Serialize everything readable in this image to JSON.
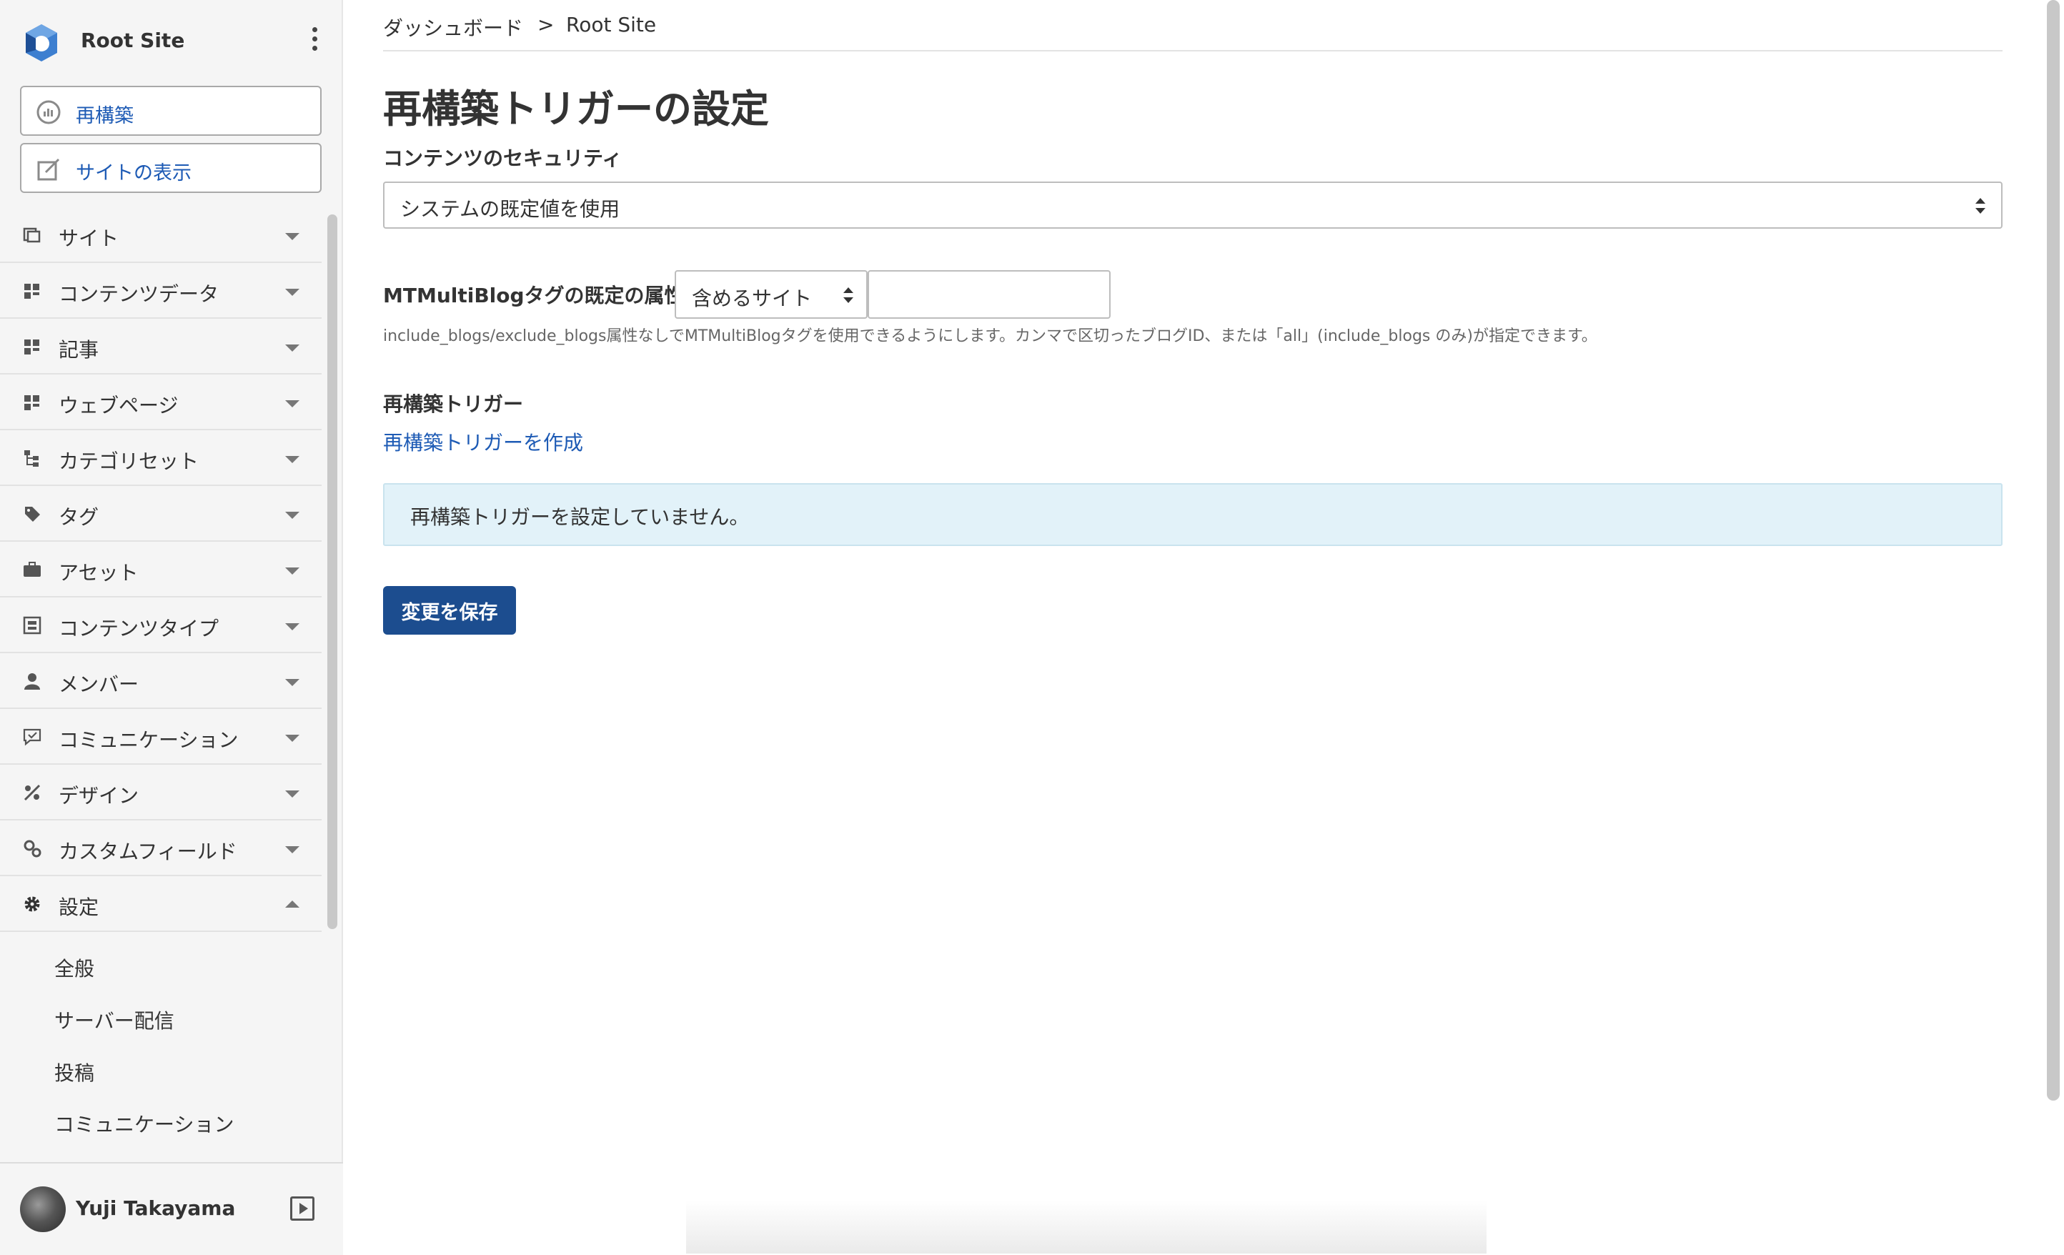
{
  "sidebar": {
    "site_name": "Root Site",
    "buttons": {
      "rebuild": "再構築",
      "view_site": "サイトの表示"
    },
    "menu": [
      {
        "label": "サイト",
        "icon": "sites-icon"
      },
      {
        "label": "コンテンツデータ",
        "icon": "content-data-icon"
      },
      {
        "label": "記事",
        "icon": "entries-icon"
      },
      {
        "label": "ウェブページ",
        "icon": "pages-icon"
      },
      {
        "label": "カテゴリセット",
        "icon": "category-set-icon"
      },
      {
        "label": "タグ",
        "icon": "tag-icon"
      },
      {
        "label": "アセット",
        "icon": "assets-icon"
      },
      {
        "label": "コンテンツタイプ",
        "icon": "content-type-icon"
      },
      {
        "label": "メンバー",
        "icon": "member-icon"
      },
      {
        "label": "コミュニケーション",
        "icon": "communication-icon"
      },
      {
        "label": "デザイン",
        "icon": "design-icon"
      },
      {
        "label": "カスタムフィールド",
        "icon": "custom-fields-icon"
      },
      {
        "label": "設定",
        "icon": "gear-icon",
        "expanded": true
      }
    ],
    "submenu": [
      "全般",
      "サーバー配信",
      "投稿",
      "コミュニケーション"
    ],
    "user_name": "Yuji Takayama"
  },
  "breadcrumb": {
    "home": "ダッシュボード",
    "separator": ">",
    "current": "Root Site"
  },
  "page": {
    "title": "再構築トリガーの設定",
    "content_security": {
      "label": "コンテンツのセキュリティ",
      "selected": "システムの既定値を使用"
    },
    "multiblog": {
      "label": "MTMultiBlogタグの既定の属性:",
      "selected": "含めるサイト",
      "value": "",
      "help": "include_blogs/exclude_blogs属性なしでMTMultiBlogタグを使用できるようにします。カンマで区切ったブログID、または「all」(include_blogs のみ)が指定できます。"
    },
    "rebuild_trigger": {
      "label": "再構築トリガー",
      "create_link": "再構築トリガーを作成",
      "empty_message": "再構築トリガーを設定していません。"
    },
    "save_button": "変更を保存"
  },
  "colors": {
    "accent": "#1e5bb5",
    "save_button": "#1c4d8f",
    "info_bg": "#e2f2f9"
  }
}
